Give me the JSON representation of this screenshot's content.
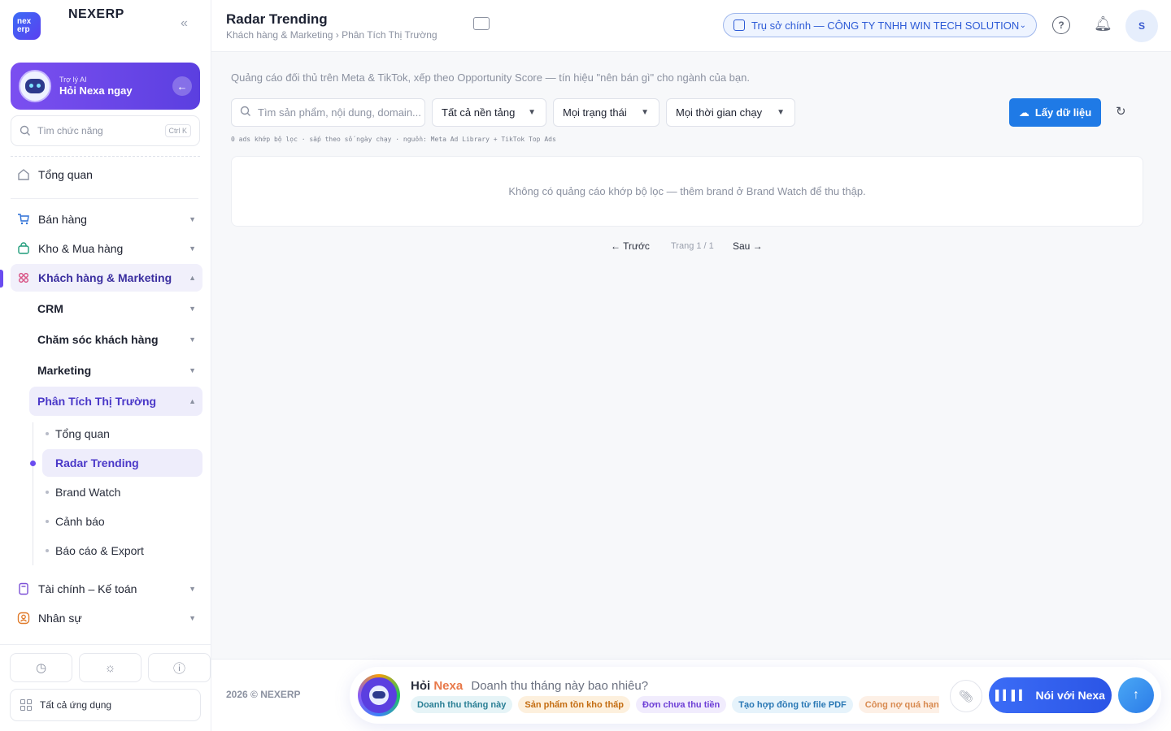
{
  "app": {
    "brand": "NEXERP",
    "logo_text_1": "nex",
    "logo_text_2": "erp"
  },
  "ai_card": {
    "subtitle": "Trợ lý AI",
    "title": "Hỏi Nexa ngay"
  },
  "side_search": {
    "placeholder": "Tìm chức năng",
    "shortcut": "Ctrl K"
  },
  "sidebar": {
    "overview": "Tổng quan",
    "groups": [
      {
        "label": "Bán hàng",
        "icon": "cart-icon"
      },
      {
        "label": "Kho & Mua hàng",
        "icon": "bag-icon"
      },
      {
        "label": "Khách hàng & Marketing",
        "icon": "users-icon"
      }
    ],
    "sub_items": [
      "CRM",
      "Chăm sóc khách hàng",
      "Marketing",
      "Phân Tích Thị Trường"
    ],
    "leaves": [
      "Tổng quan",
      "Radar Trending",
      "Brand Watch",
      "Cảnh báo",
      "Báo cáo & Export"
    ],
    "more_groups": [
      {
        "label": "Tài chính – Kế toán",
        "icon": "calculator-icon"
      },
      {
        "label": "Nhân sự",
        "icon": "person-icon"
      }
    ],
    "all_apps": "Tất cả ứng dụng"
  },
  "header": {
    "title": "Radar Trending",
    "breadcrumb": "Khách hàng & Marketing › Phân Tích Thị Trường",
    "company": "Trụ sở chính — CÔNG TY TNHH WIN TECH SOLUTION",
    "help": "?",
    "avatar": "S"
  },
  "main": {
    "description": "Quảng cáo đối thủ trên Meta & TikTok, xếp theo Opportunity Score — tín hiệu \"nên bán gì\" cho ngành của bạn.",
    "search_placeholder": "Tìm sản phẩm, nội dung, domain...",
    "filters": {
      "platform": "Tất cả nền tảng",
      "status": "Mọi trạng thái",
      "runtime": "Mọi thời gian chạy"
    },
    "fetch_button": "Lấy dữ liệu",
    "meta_line": "0 ads khớp bộ lọc · sắp theo số ngày chạy · nguồn: Meta Ad Library + TikTok Top Ads",
    "empty_message": "Không có quảng cáo khớp bộ lọc — thêm brand ở Brand Watch để thu thập.",
    "pager": {
      "prev": "← Trước",
      "info": "Trang 1 / 1",
      "next": "Sau →"
    }
  },
  "footer": {
    "copyright": "2026 © NEXERP",
    "ask_label_1": "Hỏi",
    "ask_label_2": "Nexa",
    "ask_placeholder": "Doanh thu tháng này bao nhiêu?",
    "chips": [
      {
        "label": "Doanh thu tháng này",
        "bg": "#e6f4f7",
        "fg": "#2a7f95"
      },
      {
        "label": "Sản phẩm tồn kho thấp",
        "bg": "#fdf0dd",
        "fg": "#c46d12"
      },
      {
        "label": "Đơn chưa thu tiền",
        "bg": "#f1ecfd",
        "fg": "#6d3fd6"
      },
      {
        "label": "Tạo hợp đồng từ file PDF",
        "bg": "#e6f3fb",
        "fg": "#2a78b5"
      },
      {
        "label": "Công nợ quá hạn",
        "bg": "#fdf0e6",
        "fg": "#d88a50"
      }
    ],
    "talk_button": "Nói với Nexa"
  }
}
